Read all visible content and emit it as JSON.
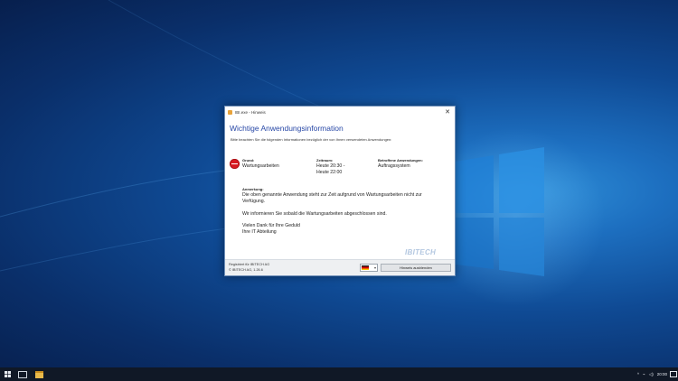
{
  "window": {
    "title": "IBI.exe - Hinweis",
    "close_glyph": "✕"
  },
  "dialog": {
    "heading": "Wichtige Anwendungsinformation",
    "intro": "Bitte beachten Sie die folgenden Informationen bezüglich der von Ihnen verwendeten Anwendungen:",
    "grund_label": "Grund:",
    "grund_value": "Wartungsarbeiten",
    "zeitraum_label": "Zeitraum:",
    "zeitraum_from": "Heute 20:30 -",
    "zeitraum_to": "Heute 22:00",
    "apps_label": "Betroffene Anwendungen:",
    "apps_value": "Auftragssystem",
    "note_label": "Anmerkung:",
    "note_text": "Die oben genannte Anwendung steht zur Zeit aufgrund von Wartungsarbeiten nicht zur Verfügung.",
    "info_text": "Wir informieren Sie sobald die Wartungsarbeiten abgeschlossen sind.",
    "thanks": "Vielen Dank für Ihre Geduld",
    "signature": "Ihre IT Abteilung",
    "brand": "IBITECH"
  },
  "footer": {
    "registered": "Registriert für IBITECH AG",
    "copyright": "© IBITECH AG, 1.26.6",
    "language_icon": "flag-de-icon",
    "hide_button": "Hinweis ausblenden"
  },
  "taskbar": {
    "clock": "20:00",
    "tray_glyph": "^"
  }
}
